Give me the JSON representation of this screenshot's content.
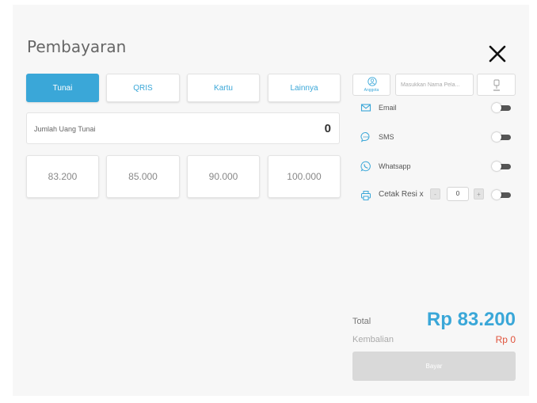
{
  "header": {
    "title": "Pembayaran"
  },
  "tabs": [
    {
      "label": "Tunai",
      "active": true
    },
    {
      "label": "QRIS"
    },
    {
      "label": "Kartu"
    },
    {
      "label": "Lainnya"
    }
  ],
  "cash": {
    "label": "Jumlah Uang Tunai",
    "value": "0"
  },
  "amounts": [
    "83.200",
    "85.000",
    "90.000",
    "100.000"
  ],
  "member": {
    "button_label": "Anggota",
    "input_placeholder": "Masukkan Nama Pela..."
  },
  "options": [
    {
      "label": "Email",
      "icon": "email-icon",
      "enabled": false
    },
    {
      "label": "SMS",
      "icon": "sms-icon",
      "enabled": false
    },
    {
      "label": "Whatsapp",
      "icon": "whatsapp-icon",
      "enabled": false
    },
    {
      "label": "Cetak Resi x",
      "icon": "printer-icon",
      "enabled": false
    }
  ],
  "receipt_copies": {
    "value": "0",
    "minus": "-",
    "plus": "+"
  },
  "summary": {
    "total_label": "Total",
    "total_value": "Rp 83.200",
    "change_label": "Kembalian",
    "change_value": "Rp 0"
  },
  "pay_button": {
    "label": "Bayar"
  },
  "colors": {
    "accent": "#3aa7d8",
    "change": "#e0533c",
    "disabled": "#d9d9d9"
  }
}
